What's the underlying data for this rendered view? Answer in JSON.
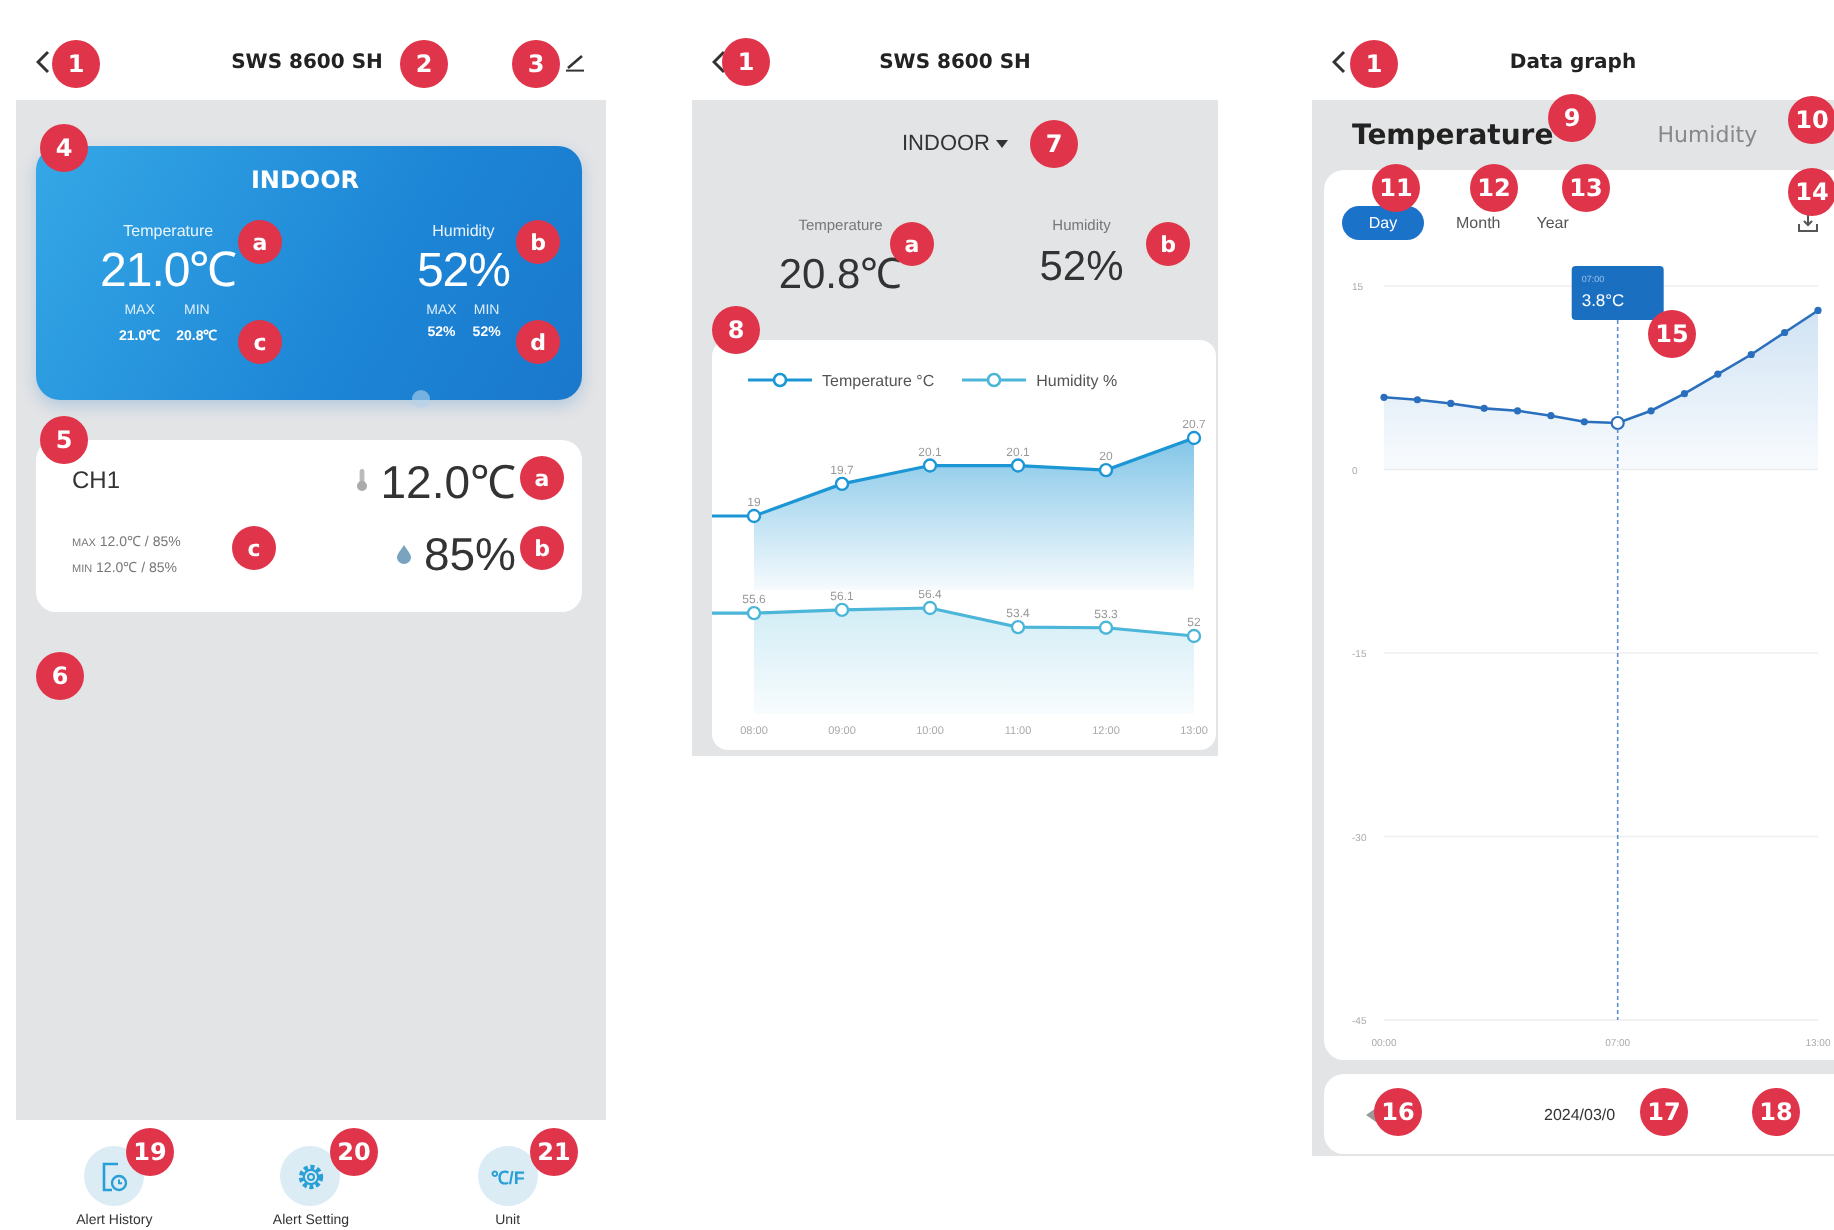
{
  "screen_1": {
    "header": {
      "title": "SWS 8600 SH"
    },
    "indoor_card": {
      "title": "INDOOR",
      "temperature": {
        "label": "Temperature",
        "value": "21.0℃",
        "max_label": "MAX",
        "max": "21.0℃",
        "min_label": "MIN",
        "min": "20.8℃"
      },
      "humidity": {
        "label": "Humidity",
        "value": "52%",
        "max_label": "MAX",
        "max": "52%",
        "min_label": "MIN",
        "min": "52%"
      }
    },
    "channel_card": {
      "name": "CH1",
      "temperature": "12.0℃",
      "humidity": "85%",
      "max_label": "MAX",
      "max": "12.0℃ / 85%",
      "min_label": "MIN",
      "min": "12.0℃ / 85%"
    },
    "bottom_nav": [
      {
        "kind": "history",
        "label": "Alert History"
      },
      {
        "kind": "settings",
        "label": "Alert Setting"
      },
      {
        "kind": "unit",
        "label": "Unit",
        "icon_text": "℃/F"
      }
    ],
    "callouts": [
      "1",
      "2",
      "3",
      "4",
      "a",
      "b",
      "c",
      "d",
      "5",
      "a",
      "b",
      "c",
      "6",
      "19",
      "20",
      "21"
    ]
  },
  "screen_2": {
    "header": {
      "title": "SWS 8600 SH"
    },
    "sensor_dropdown": {
      "value": "INDOOR"
    },
    "temperature": {
      "label": "Temperature",
      "value": "20.8℃"
    },
    "humidity": {
      "label": "Humidity",
      "value": "52%"
    },
    "charts": [
      {
        "chart_data": {
          "type": "area",
          "data_labels": true,
          "series": [
            {
              "name": "Temperature °C",
              "color": "#1c96d4",
              "values": [
                19,
                19.7,
                20.1,
                20.1,
                20,
                20.7
              ]
            }
          ]
        }
      },
      {
        "chart_data": {
          "type": "area",
          "categories": [
            "08:00",
            "09:00",
            "10:00",
            "11:00",
            "12:00",
            "13:00"
          ],
          "data_labels": true,
          "series": [
            {
              "name": "Humidity %",
              "color": "#4cb6d9",
              "values": [
                55.6,
                56.1,
                56.4,
                53.4,
                53.3,
                52
              ]
            }
          ]
        }
      }
    ],
    "callouts": [
      "1",
      "7",
      "a",
      "b",
      "8"
    ]
  },
  "screen_3": {
    "header": {
      "title": "Data graph"
    },
    "metric_tabs": [
      {
        "label": "Temperature",
        "selected": true
      },
      {
        "label": "Humidity",
        "selected": false
      }
    ],
    "range_tabs": [
      {
        "label": "Day",
        "selected": true
      },
      {
        "label": "Month",
        "selected": false
      },
      {
        "label": "Year",
        "selected": false
      }
    ],
    "chart_data": {
      "type": "area",
      "grid": true,
      "x": [
        0,
        1,
        2,
        3,
        4,
        5,
        6,
        7,
        8,
        9,
        10,
        11,
        12,
        13
      ],
      "values": [
        5.9,
        5.7,
        5.4,
        5.0,
        4.8,
        4.4,
        3.9,
        3.8,
        4.8,
        6.2,
        7.8,
        9.4,
        11.2,
        13.0
      ],
      "xlim": [
        0,
        13
      ],
      "ylim": [
        -45,
        15
      ],
      "yticks": [
        15,
        0,
        -15,
        -30,
        -45
      ],
      "xticks": [
        {
          "value": 0,
          "label": "00:00"
        },
        {
          "value": 7,
          "label": "07:00"
        },
        {
          "value": 13,
          "label": "13:00"
        }
      ],
      "annotations": [
        "3.8°C"
      ]
    },
    "tooltip": {
      "time": "07:00"
    },
    "date": "2024/03/0",
    "callouts": [
      "1",
      "9",
      "10",
      "11",
      "12",
      "13",
      "14",
      "15",
      "16",
      "17",
      "18"
    ]
  }
}
